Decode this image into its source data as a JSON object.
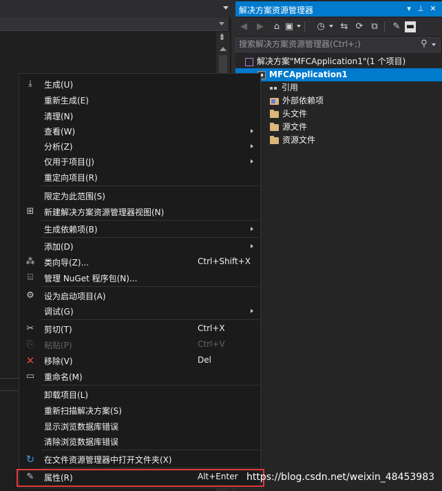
{
  "solution_explorer": {
    "title": "解决方案资源管理器",
    "search_placeholder": "搜索解决方案资源管理器(Ctrl+;)",
    "tree": {
      "solution": "解决方案\"MFCApplication1\"(1 个项目)",
      "project": "MFCApplication1",
      "children": [
        "引用",
        "外部依赖项",
        "头文件",
        "源文件",
        "资源文件"
      ]
    }
  },
  "context_menu": {
    "items": [
      {
        "label": "生成(U)",
        "shortcut": "",
        "submenu": false,
        "disabled": false
      },
      {
        "label": "重新生成(E)",
        "shortcut": "",
        "submenu": false,
        "disabled": false
      },
      {
        "label": "清理(N)",
        "shortcut": "",
        "submenu": false,
        "disabled": false
      },
      {
        "label": "查看(W)",
        "shortcut": "",
        "submenu": true,
        "disabled": false
      },
      {
        "label": "分析(Z)",
        "shortcut": "",
        "submenu": true,
        "disabled": false
      },
      {
        "label": "仅用于项目(J)",
        "shortcut": "",
        "submenu": true,
        "disabled": false
      },
      {
        "label": "重定向项目(R)",
        "shortcut": "",
        "submenu": false,
        "disabled": false
      },
      {
        "label": "限定为此范围(S)",
        "shortcut": "",
        "submenu": false,
        "disabled": false
      },
      {
        "label": "新建解决方案资源管理器视图(N)",
        "shortcut": "",
        "submenu": false,
        "disabled": false
      },
      {
        "label": "生成依赖项(B)",
        "shortcut": "",
        "submenu": true,
        "disabled": false
      },
      {
        "label": "添加(D)",
        "shortcut": "",
        "submenu": true,
        "disabled": false
      },
      {
        "label": "类向导(Z)...",
        "shortcut": "Ctrl+Shift+X",
        "submenu": false,
        "disabled": false
      },
      {
        "label": "管理 NuGet 程序包(N)...",
        "shortcut": "",
        "submenu": false,
        "disabled": false
      },
      {
        "label": "设为启动项目(A)",
        "shortcut": "",
        "submenu": false,
        "disabled": false
      },
      {
        "label": "调试(G)",
        "shortcut": "",
        "submenu": true,
        "disabled": false
      },
      {
        "label": "剪切(T)",
        "shortcut": "Ctrl+X",
        "submenu": false,
        "disabled": false
      },
      {
        "label": "粘贴(P)",
        "shortcut": "Ctrl+V",
        "submenu": false,
        "disabled": true
      },
      {
        "label": "移除(V)",
        "shortcut": "Del",
        "submenu": false,
        "disabled": false
      },
      {
        "label": "重命名(M)",
        "shortcut": "",
        "submenu": false,
        "disabled": false
      },
      {
        "label": "卸载项目(L)",
        "shortcut": "",
        "submenu": false,
        "disabled": false
      },
      {
        "label": "重新扫描解决方案(S)",
        "shortcut": "",
        "submenu": false,
        "disabled": false
      },
      {
        "label": "显示浏览数据库错误",
        "shortcut": "",
        "submenu": false,
        "disabled": false
      },
      {
        "label": "清除浏览数据库错误",
        "shortcut": "",
        "submenu": false,
        "disabled": false
      },
      {
        "label": "在文件资源管理器中打开文件夹(X)",
        "shortcut": "",
        "submenu": false,
        "disabled": false
      },
      {
        "label": "属性(R)",
        "shortcut": "Alt+Enter",
        "submenu": false,
        "disabled": false
      }
    ]
  },
  "watermark": "https://blog.csdn.net/weixin_48453983",
  "colors": {
    "accent": "#007acc",
    "highlight_box": "#e33a3a"
  }
}
